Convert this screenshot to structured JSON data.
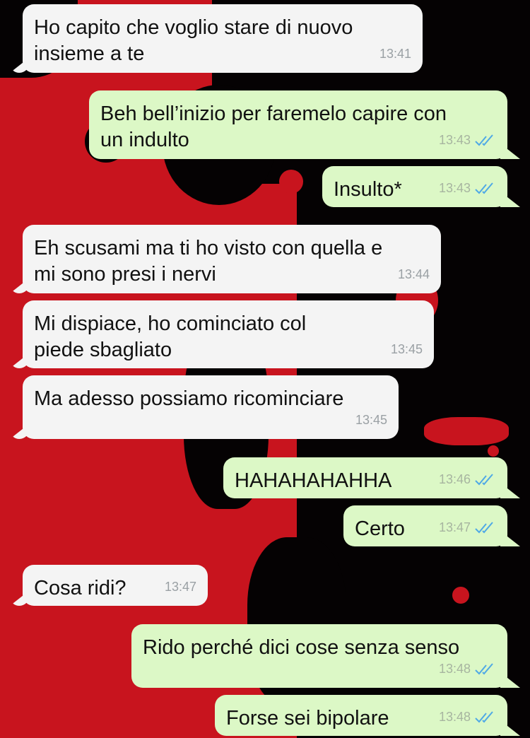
{
  "colors": {
    "wallpaper_red": "#c8141e",
    "wallpaper_black": "#050203",
    "incoming_bubble": "#f4f4f4",
    "outgoing_bubble": "#dcf8c6",
    "read_tick": "#4fa9e6"
  },
  "messages": [
    {
      "direction": "in",
      "text": "Ho capito che voglio stare di nuovo\ninsieme a te",
      "time": "13:41"
    },
    {
      "direction": "out",
      "text": "Beh bell’inizio per faremelo capire con\nun indulto",
      "time": "13:43",
      "status_icon": "double-check-icon"
    },
    {
      "direction": "out",
      "text": "Insulto*",
      "time": "13:43",
      "status_icon": "double-check-icon"
    },
    {
      "direction": "in",
      "text": "Eh scusami ma ti ho visto con quella e\nmi sono presi i nervi",
      "time": "13:44"
    },
    {
      "direction": "in",
      "text": "Mi dispiace, ho cominciato col\npiede sbagliato",
      "time": "13:45"
    },
    {
      "direction": "in",
      "text": "Ma adesso possiamo ricominciare",
      "time": "13:45"
    },
    {
      "direction": "out",
      "text": "HAHAHAHAHHA",
      "time": "13:46",
      "status_icon": "double-check-icon"
    },
    {
      "direction": "out",
      "text": "Certo",
      "time": "13:47",
      "status_icon": "double-check-icon"
    },
    {
      "direction": "in",
      "text": "Cosa ridi?",
      "time": "13:47"
    },
    {
      "direction": "out",
      "text": "Rido perché dici cose senza senso",
      "time": "13:48",
      "status_icon": "double-check-icon"
    },
    {
      "direction": "out",
      "text": "Forse sei bipolare",
      "time": "13:48",
      "status_icon": "double-check-icon"
    }
  ]
}
